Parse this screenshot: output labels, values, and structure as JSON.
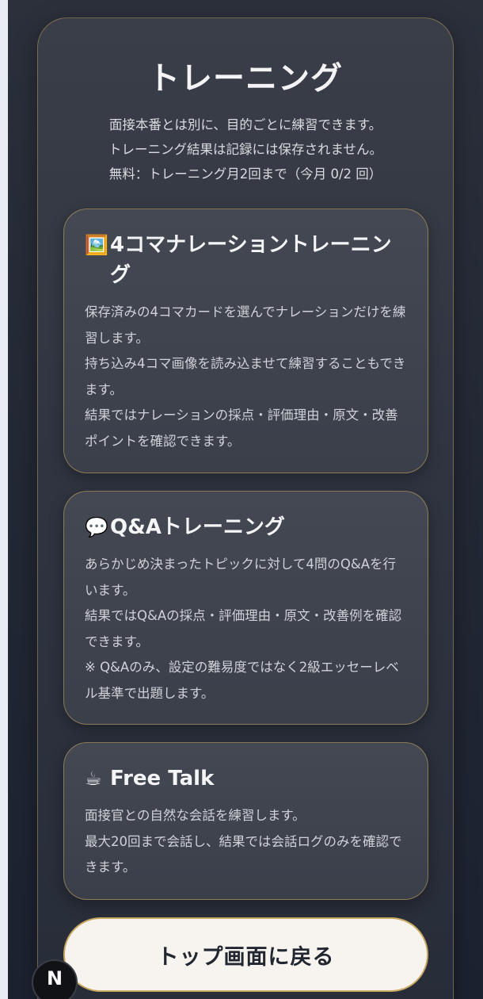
{
  "page": {
    "title": "トレーニング",
    "intro_lines": [
      "面接本番とは別に、目的ごとに練習できます。",
      "トレーニング結果は記録には保存されません。",
      "無料：トレーニング月2回まで（今月 0/2 回）"
    ]
  },
  "cards": [
    {
      "icon": "🖼️",
      "icon_name": "framed-picture-icon",
      "title": "4コマナレーショントレーニング",
      "description": [
        "保存済みの4コマカードを選んでナレーションだけを練習します。",
        "持ち込み4コマ画像を読み込ませて練習することもできます。",
        "結果ではナレーションの採点・評価理由・原文・改善ポイントを確認できます。"
      ]
    },
    {
      "icon": "💬",
      "icon_name": "speech-bubble-icon",
      "title": "Q&Aトレーニング",
      "description": [
        "あらかじめ決まったトピックに対して4問のQ&Aを行います。",
        "結果ではQ&Aの採点・評価理由・原文・改善例を確認できます。",
        "※ Q&Aのみ、設定の難易度ではなく2級エッセーレベル基準で出題します。"
      ]
    },
    {
      "icon": "☕",
      "icon_name": "coffee-icon",
      "title": "Free Talk",
      "description": [
        "面接官との自然な会話を練習します。",
        "最大20回まで会話し、結果では会話ログのみを確認できます。"
      ]
    }
  ],
  "back_button": {
    "label": "トップ画面に戻る"
  },
  "badge": {
    "label": "N"
  },
  "colors": {
    "accent_border": "#c9a860",
    "panel_bg": "#30343f",
    "button_bg": "#f7f4ef"
  }
}
